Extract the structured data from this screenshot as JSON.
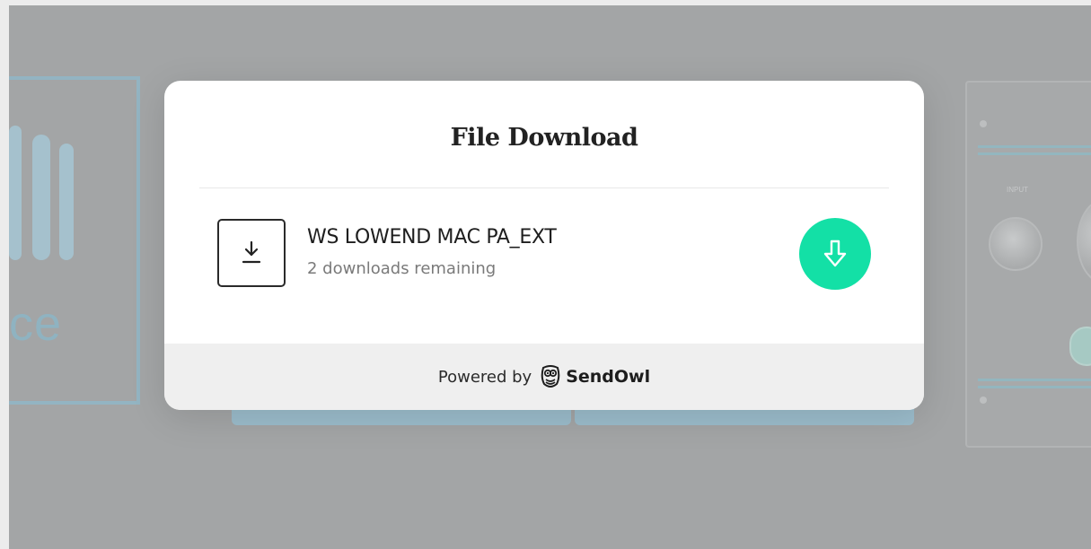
{
  "colors": {
    "overlay": "#a3a5a6",
    "modal_bg": "#ffffff",
    "footer_bg": "#efefef",
    "accent_green": "#13e0a6",
    "title_text": "#222222",
    "muted_text": "#7a7a7a"
  },
  "background": {
    "logo_text": "ce",
    "device_label": "INPUT"
  },
  "modal": {
    "title": "File Download",
    "file": {
      "icon": "download-tray-icon",
      "name": "WS LOWEND MAC PA_EXT",
      "remaining": "2 downloads remaining"
    },
    "download_button": {
      "icon": "arrow-down-icon"
    },
    "footer": {
      "powered_by": "Powered by",
      "brand": "SendOwl",
      "brand_icon": "owl-icon"
    }
  }
}
